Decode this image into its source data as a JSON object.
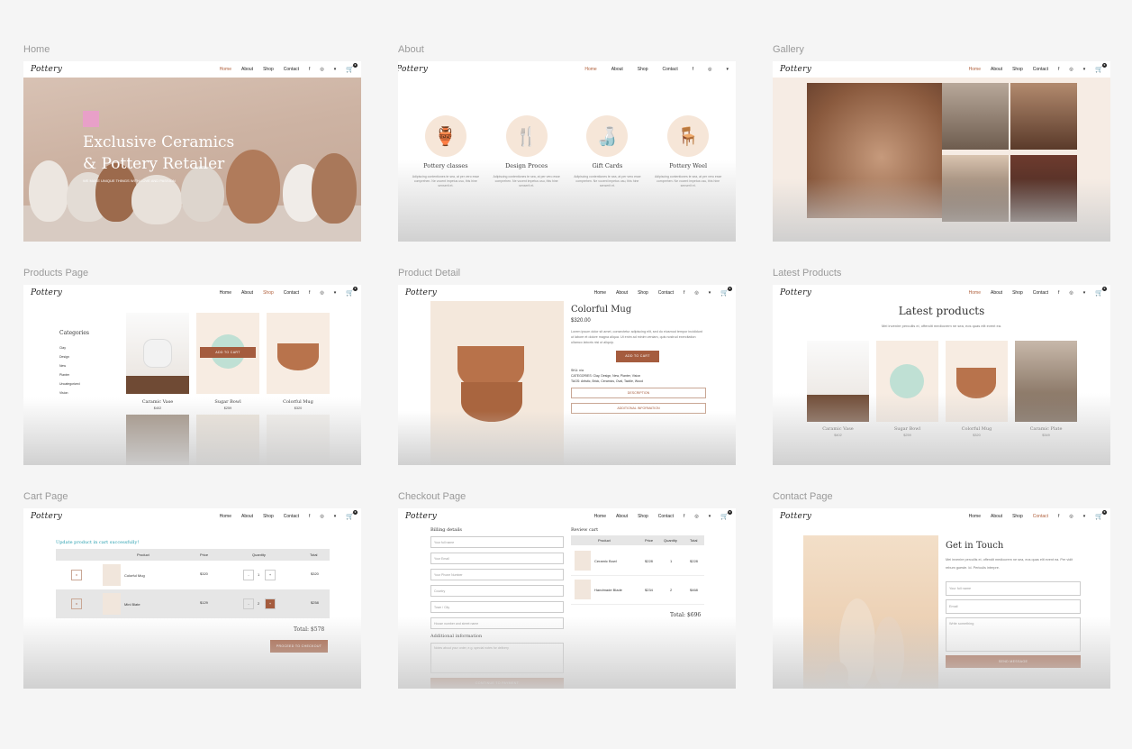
{
  "nav": {
    "logo": "Pottery",
    "home": "Home",
    "about": "About",
    "shop": "Shop",
    "contact": "Contact",
    "fb": "f",
    "ig": "◎",
    "tw": "♥",
    "cart_count": "0"
  },
  "frames": {
    "home": {
      "label": "Home",
      "title_line1": "Exclusive Ceramics",
      "title_line2": "& Pottery Retailer",
      "tagline": "WE MAKE UNIQUE THINGS WITH LOVE AND PASSION"
    },
    "about": {
      "label": "About",
      "features": [
        {
          "title": "Pottery classes",
          "text": "Adipiscing contentiones te sea, at per vero esse comprehen. Ne vocent impetus usu, this hine senserit et."
        },
        {
          "title": "Design Proces",
          "text": "Adipiscing contentiones te sea, at per vero esse comprehen. Ne vocent impetus usu, this hine senserit et."
        },
        {
          "title": "Gift Cards",
          "text": "Adipiscing contentiones te sea, at per vero esse comprehen. Ne vocent impetus usu, this hine senserit et."
        },
        {
          "title": "Pottery Weel",
          "text": "Adipiscing contentiones te sea, at per vero esse comprehen. Ne vocent impetus usu, this hine senserit et."
        }
      ]
    },
    "gallery": {
      "label": "Gallery"
    },
    "products": {
      "label": "Products Page",
      "categories_title": "Categories",
      "categories": [
        "Clay",
        "Design",
        "New",
        "Planter",
        "Uncategorized",
        "Vision"
      ],
      "add_to_cart": "ADD TO CART",
      "items": [
        {
          "name": "Caramic Vase",
          "price": "$402"
        },
        {
          "name": "Sugar Bowl",
          "price": "$259"
        },
        {
          "name": "Colorful Mug",
          "price": "$320"
        }
      ]
    },
    "detail": {
      "label": "Product Detail",
      "name": "Colorful Mug",
      "price": "$320.00",
      "desc": "Lorem ipsum dolor sit amet, consectetur adipiscing elit, sed do eiusmod tempor incididunt ut labore et dolore magna aliqua. Ut enim ad minim veniam, quis nostrud exercitation ullamco laboris nisi ut aliquip.",
      "add_to_cart": "ADD TO CART",
      "sku": "SKU: n/a",
      "categories": "CATEGORIES: Clay, Design, New, Planter, Vision",
      "tags": "TAGS: Artistic, Brick, Ceramics, Oval, Tactile, Wood",
      "tab1": "DESCRIPTION",
      "tab2": "ADDITIONAL INFORMATION"
    },
    "latest": {
      "label": "Latest Products",
      "title": "Latest products",
      "subtitle": "Mei invenire percullis ei, offendit mediocrem ne sea, eos quas elit event ea.",
      "items": [
        {
          "name": "Caramic Vase",
          "price": "$402"
        },
        {
          "name": "Sugar Bowl",
          "price": "$259"
        },
        {
          "name": "Colorful Mug",
          "price": "$320"
        },
        {
          "name": "Caramic Plate",
          "price": "$349"
        }
      ]
    },
    "cart": {
      "label": "Cart Page",
      "notice": "Update product in cart successfully!",
      "headers": [
        "Product",
        "Price",
        "Quantity",
        "Total"
      ],
      "rows": [
        {
          "remove": "x",
          "name": "Colorful Mug",
          "price": "$320",
          "qty": "1",
          "total": "$320"
        },
        {
          "remove": "x",
          "name": "Mini Blate",
          "price": "$129",
          "qty": "2",
          "total": "$258"
        }
      ],
      "total": "Total: $578",
      "checkout": "PROCEED TO CHECKOUT",
      "minus": "-",
      "plus": "+"
    },
    "checkout": {
      "label": "Checkout Page",
      "billing": "Billing details",
      "fields": [
        "Your full name",
        "Your Email",
        "Your Phone Number",
        "Country",
        "Town / City",
        "House number and street name"
      ],
      "additional": "Additional information",
      "notes": "Notes about your order, e.g. special notes for delivery",
      "continue": "CONTINUE TO PAYMENT",
      "review": "Review cart",
      "headers": [
        "Product",
        "Price",
        "Quantity",
        "Total"
      ],
      "rows": [
        {
          "name": "Ceramic Bowl",
          "price": "$228",
          "qty": "1",
          "total": "$228"
        },
        {
          "name": "Handmade Blade",
          "price": "$234",
          "qty": "2",
          "total": "$468"
        }
      ],
      "total": "Total: $696"
    },
    "contact": {
      "label": "Contact Page",
      "title": "Get in Touch",
      "text": "Mei invenire percullis ei, offendit mediocrem ne sea, eos quas elit event ea. Per vidit rebum gueste. Id. Periculis interpre.",
      "name": "Your full name",
      "email": "Email",
      "message": "Write something",
      "send": "SEND MESSAGE"
    }
  }
}
